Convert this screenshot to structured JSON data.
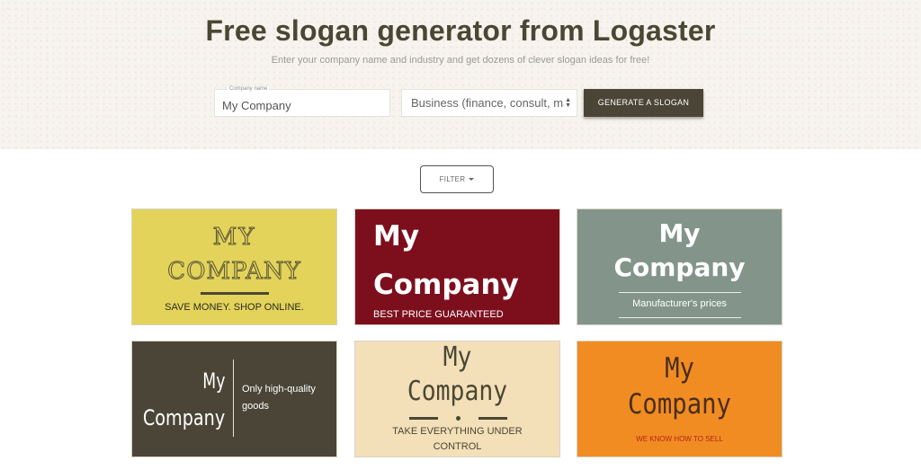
{
  "header": {
    "title": "Free slogan generator from Logaster",
    "subtitle": "Enter your company name and industry and get dozens of clever slogan ideas for free!"
  },
  "form": {
    "company_label": "Company name",
    "company_value": "My Company",
    "industry_value": "Business (finance, consult, ma",
    "generate_label": "GENERATE A SLOGAN"
  },
  "filter": {
    "label": "FILTER"
  },
  "cards": [
    {
      "line1": "MY",
      "line2": "COMPANY",
      "slogan": "SAVE MONEY. SHOP ONLINE.",
      "bg": "#e3d35b"
    },
    {
      "line1": "My",
      "line2": "Company",
      "slogan": "BEST PRICE GUARANTEED",
      "bg": "#7d0f1d"
    },
    {
      "line1": "My",
      "line2": "Company",
      "slogan": "Manufacturer's prices",
      "bg": "#83958b"
    },
    {
      "line1": "My",
      "line2": "Company",
      "slogan1": "Only high-quality",
      "slogan2": "goods",
      "bg": "#4a4536"
    },
    {
      "line1": "My",
      "line2": "Company",
      "slogan1": "TAKE EVERYTHING UNDER",
      "slogan2": "CONTROL",
      "bg": "#f3dfb8"
    },
    {
      "line1": "My",
      "line2": "Company",
      "slogan": "WE KNOW HOW TO SELL",
      "bg": "#f08c22"
    }
  ]
}
